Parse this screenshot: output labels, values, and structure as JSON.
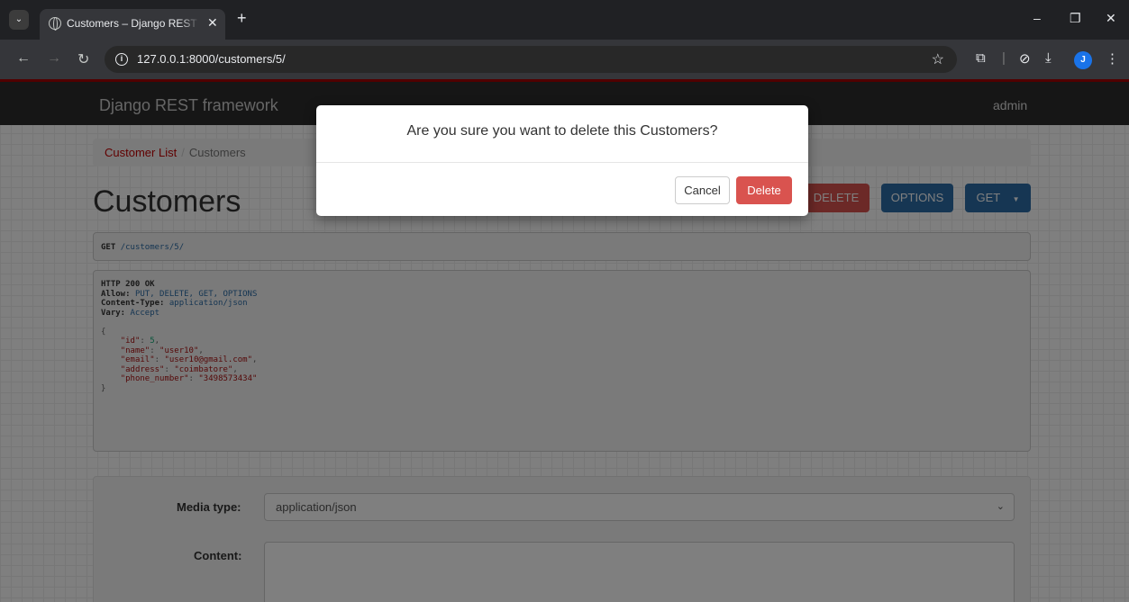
{
  "browser": {
    "tab_title": "Customers – Django REST framework",
    "url": "127.0.0.1:8000/customers/5/",
    "profile_initial": "J"
  },
  "navbar": {
    "brand": "Django REST framework",
    "user": "admin"
  },
  "breadcrumb": {
    "link": "Customer List",
    "separator": "/",
    "active": "Customers"
  },
  "page_title": "Customers",
  "buttons": {
    "delete": "DELETE",
    "options": "OPTIONS",
    "get": "GET"
  },
  "request": {
    "method": "GET",
    "path": "/customers/5/"
  },
  "response": {
    "status": "HTTP 200 OK",
    "headers": [
      {
        "name": "Allow:",
        "value": "PUT, DELETE, GET, OPTIONS"
      },
      {
        "name": "Content-Type:",
        "value": "application/json"
      },
      {
        "name": "Vary:",
        "value": "Accept"
      }
    ],
    "body": [
      {
        "key": "\"id\"",
        "value": "5",
        "suffix": ","
      },
      {
        "key": "\"name\"",
        "value": "\"user10\"",
        "suffix": ","
      },
      {
        "key": "\"email\"",
        "value": "\"user10@gmail.com\"",
        "suffix": ","
      },
      {
        "key": "\"address\"",
        "value": "\"coimbatore\"",
        "suffix": ","
      },
      {
        "key": "\"phone_number\"",
        "value": "\"3498573434\"",
        "suffix": ""
      }
    ],
    "open_brace": "{",
    "close_brace": "}"
  },
  "form": {
    "media_type_label": "Media type:",
    "media_type_value": "application/json",
    "content_label": "Content:"
  },
  "modal": {
    "title": "Are you sure you want to delete this Customers?",
    "cancel": "Cancel",
    "delete": "Delete"
  }
}
